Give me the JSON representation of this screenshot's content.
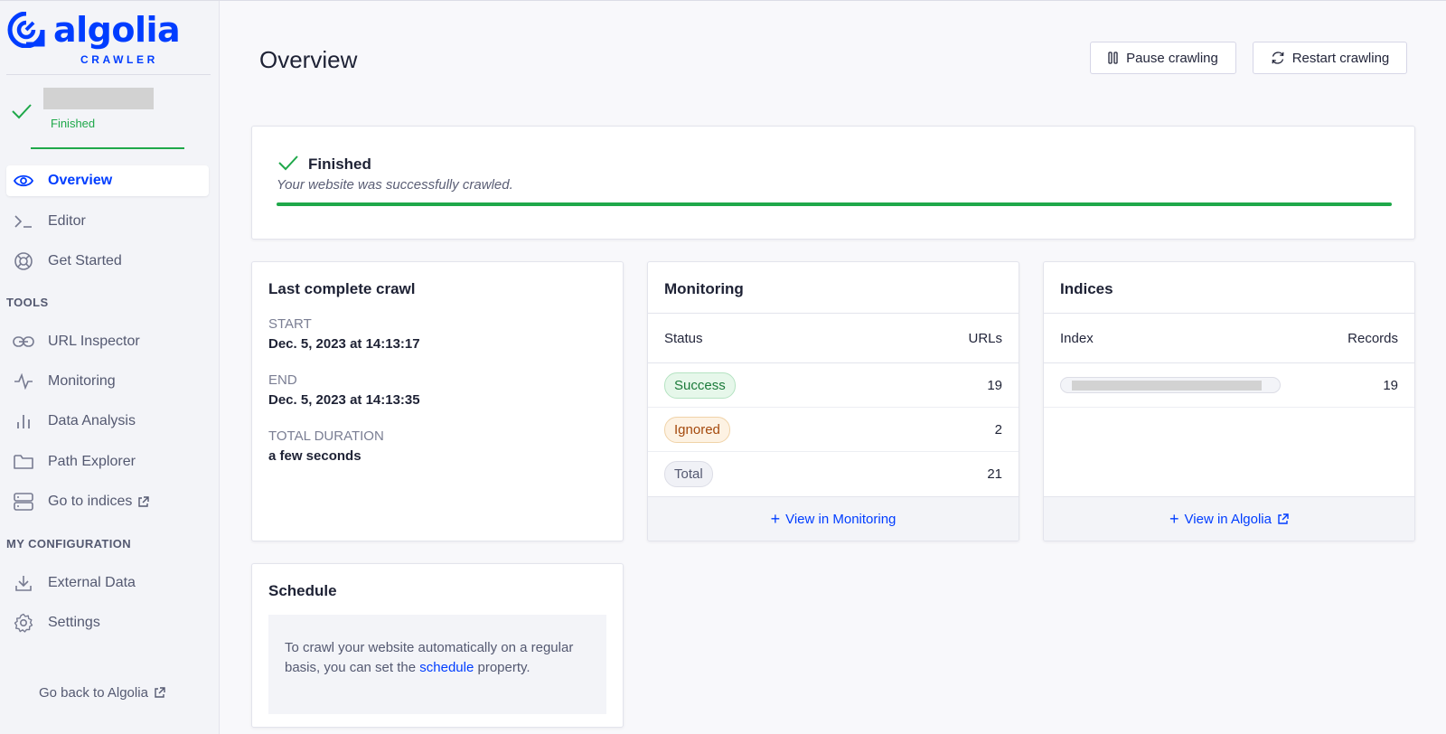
{
  "brand": {
    "name": "algolia",
    "product": "CRAWLER",
    "color": "#003dff"
  },
  "crawler": {
    "state": "Finished",
    "status_color": "#1fa84a"
  },
  "sidebar": {
    "items": [
      {
        "label": "Overview",
        "icon": "eye-icon",
        "active": true
      },
      {
        "label": "Editor",
        "icon": "terminal-icon"
      },
      {
        "label": "Get Started",
        "icon": "lifebuoy-icon"
      }
    ],
    "tools_heading": "TOOLS",
    "tools": [
      {
        "label": "URL Inspector",
        "icon": "link-icon"
      },
      {
        "label": "Monitoring",
        "icon": "activity-icon"
      },
      {
        "label": "Data Analysis",
        "icon": "bar-chart-icon"
      },
      {
        "label": "Path Explorer",
        "icon": "folder-icon"
      },
      {
        "label": "Go to indices",
        "icon": "server-icon"
      }
    ],
    "config_heading": "MY CONFIGURATION",
    "config": [
      {
        "label": "External Data",
        "icon": "download-icon"
      },
      {
        "label": "Settings",
        "icon": "gear-icon"
      }
    ],
    "back_link": "Go back to Algolia"
  },
  "header": {
    "title": "Overview",
    "pause_label": "Pause crawling",
    "restart_label": "Restart crawling"
  },
  "status": {
    "title": "Finished",
    "description": "Your website was successfully crawled.",
    "progress": 1.0
  },
  "last_crawl": {
    "title": "Last complete crawl",
    "start_label": "START",
    "start_value": "Dec. 5, 2023 at 14:13:17",
    "end_label": "END",
    "end_value": "Dec. 5, 2023 at 14:13:35",
    "duration_label": "TOTAL DURATION",
    "duration_value": "a few seconds"
  },
  "monitoring": {
    "title": "Monitoring",
    "columns": [
      "Status",
      "URLs"
    ],
    "rows": [
      {
        "status": "Success",
        "urls": "19"
      },
      {
        "status": "Ignored",
        "urls": "2"
      },
      {
        "status": "Total",
        "urls": "21"
      }
    ],
    "footer": "View in Monitoring"
  },
  "indices": {
    "title": "Indices",
    "columns": [
      "Index",
      "Records"
    ],
    "rows": [
      {
        "records": "19"
      }
    ],
    "footer": "View in Algolia"
  },
  "schedule": {
    "title": "Schedule",
    "text_before": "To crawl your website automatically on a regular basis, you can set the",
    "link": "schedule",
    "text_after": "property."
  }
}
